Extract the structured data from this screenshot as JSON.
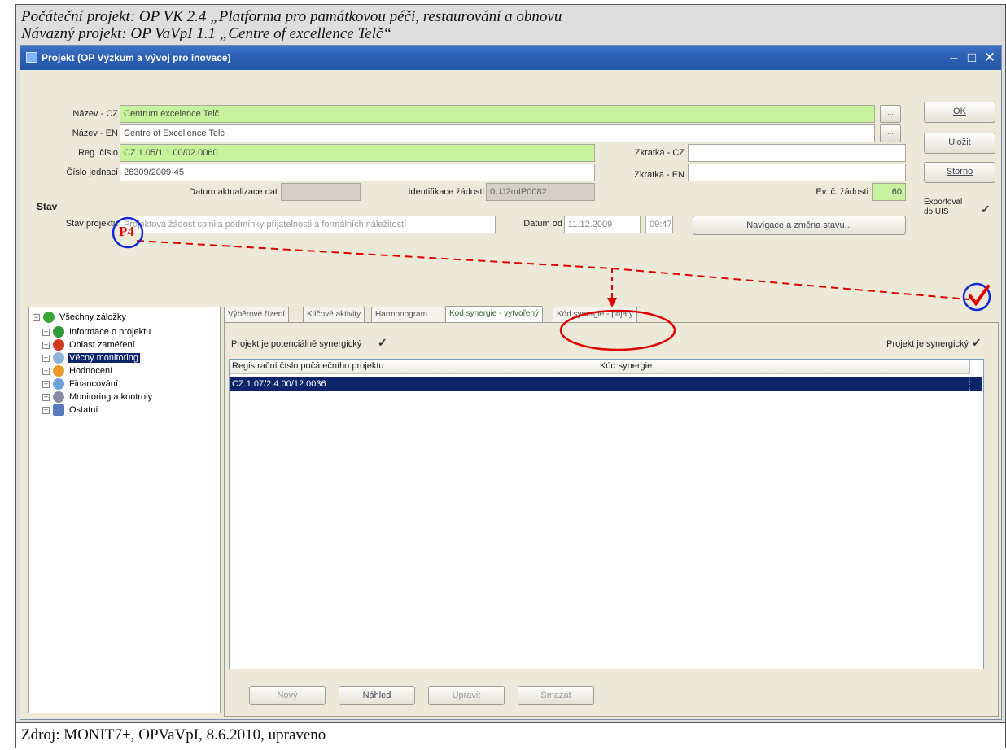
{
  "caption": {
    "line1": "Počáteční projekt: OP VK 2.4 „Platforma pro památkovou péči, restaurování a obnovu",
    "line2": "Návazný projekt: OP VaVpI 1.1 „Centre of excellence Telč“",
    "source": "Zdroj: MONIT7+, OPVaVpI, 8.6.2010, upraveno"
  },
  "window": {
    "title": "Projekt  (OP Výzkum a vývoj pro inovace)",
    "minimize": "–",
    "maximize": "□",
    "close": "✕"
  },
  "form": {
    "nazev_cz_label": "Název - CZ",
    "nazev_cz_value": "Centrum excelence Telč",
    "nazev_en_label": "Název - EN",
    "nazev_en_value": "Centre of Excellence Telc",
    "reg_cislo_label": "Reg. číslo",
    "reg_cislo_value": "CZ.1.05/1.1.00/02.0060",
    "cislo_jednaci_label": "Číslo jednací",
    "cislo_jednaci_value": "26309/2009-45",
    "datum_aktualizace_label": "Datum aktualizace dat",
    "datum_aktualizace_value": "",
    "identifikace_label": "Identifikace žádosti",
    "identifikace_value": "0UJ2mIP0082",
    "zkratka_cz_label": "Zkratka - CZ",
    "zkratka_cz_value": "",
    "zkratka_en_label": "Zkratka - EN",
    "zkratka_en_value": "",
    "ev_zadosti_label": "Ev. č. žádosti",
    "ev_zadosti_value": "60",
    "dots": "..."
  },
  "side_buttons": {
    "ok": "OK",
    "ulozit": "Uložit",
    "storno": "Storno",
    "exportoval": "Exportoval do UIS"
  },
  "stav": {
    "title": "Stav",
    "label": "Stav projektu",
    "value": "Projektová žádost splnila podmínky přijatelnosti a formálních náležitostí",
    "datum_od_label": "Datum od",
    "datum_od_value": "11.12.2009",
    "time_value": "09:47",
    "navigace_button": "Navigace a změna stavu..."
  },
  "tree": {
    "root": "Všechny záložky",
    "items": [
      "Informace o projektu",
      "Oblast zaměření",
      "Věcný monitoring",
      "Hodnocení",
      "Financování",
      "Monitoring a kontroly",
      "Ostatní"
    ]
  },
  "tabs": [
    "Výběrové řízení",
    "Klíčové aktivity",
    "Harmonogram ...",
    "Kód synergie - vytvořený",
    "Kód synergie - přijatý"
  ],
  "panel": {
    "potencialne_label": "Projekt je potenciálně synergický",
    "synergicky_label": "Projekt je synergický",
    "col1": "Registrační číslo počátečního projektu",
    "col2": "Kód synergie",
    "row1_col1": "CZ.1.07/2.4.00/12.0036",
    "row1_col2": ""
  },
  "bottom_buttons": {
    "novy": "Nový",
    "nahled": "Náhled",
    "upravit": "Upravit",
    "smazat": "Smazat"
  },
  "annotation": {
    "marker": "P4",
    "color": "#e00000",
    "circle_blue": "#1428d6"
  }
}
